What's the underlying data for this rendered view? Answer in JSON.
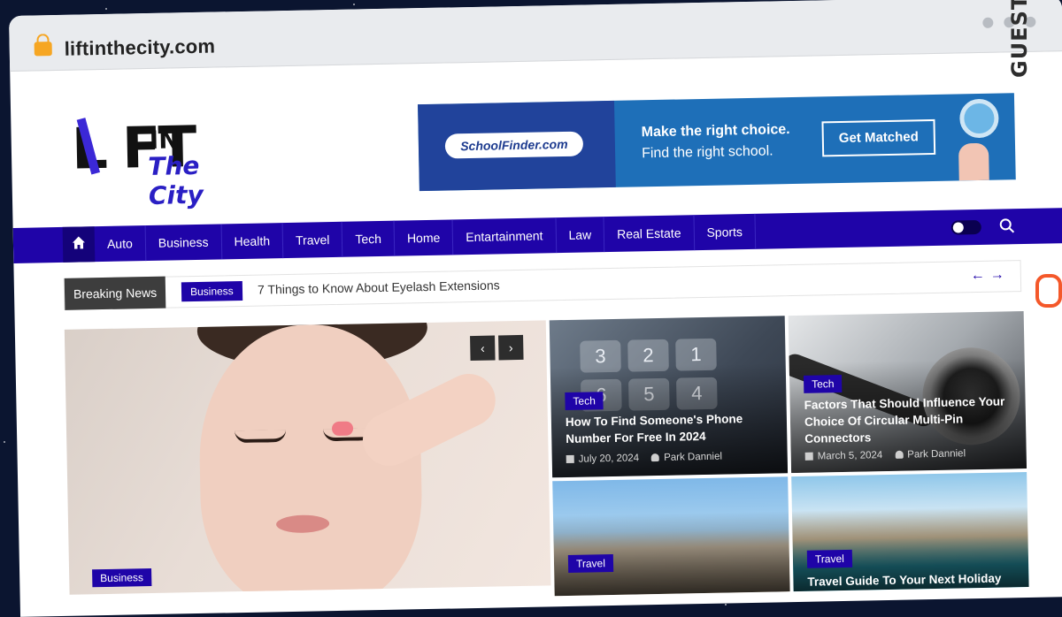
{
  "browser": {
    "url": "liftinthecity.com"
  },
  "logo": {
    "lift": "L FT",
    "in": "IN",
    "city": "The City"
  },
  "ad": {
    "brand": "SchoolFinder.com",
    "headline": "Make the right choice.",
    "subline": "Find the right school.",
    "cta": "Get Matched"
  },
  "nav": {
    "items": [
      "Auto",
      "Business",
      "Health",
      "Travel",
      "Tech",
      "Home",
      "Entartainment",
      "Law",
      "Real Estate",
      "Sports"
    ]
  },
  "breaking": {
    "label": "Breaking News",
    "badge": "Business",
    "headline": "7 Things to Know About Eyelash Extensions",
    "prev": "←",
    "next": "→"
  },
  "hero": {
    "category": "Business",
    "prev": "‹",
    "next": "›"
  },
  "cards": [
    {
      "category": "Tech",
      "title": "How To Find Someone's Phone Number For Free In 2024",
      "date": "July 20, 2024",
      "author": "Park Danniel"
    },
    {
      "category": "Tech",
      "title": "Factors That Should Influence Your Choice Of Circular Multi-Pin Connectors",
      "date": "March 5, 2024",
      "author": "Park Danniel"
    },
    {
      "category": "Travel",
      "title": ""
    },
    {
      "category": "Travel",
      "title": "Travel Guide To Your Next Holiday"
    }
  ],
  "keypad": [
    "3",
    "2",
    "1",
    "6",
    "5",
    "4"
  ],
  "watermark": {
    "text": "GUESTPOSTLINKS"
  },
  "colors": {
    "nav": "#1f04a8",
    "accent": "#f4582a"
  }
}
